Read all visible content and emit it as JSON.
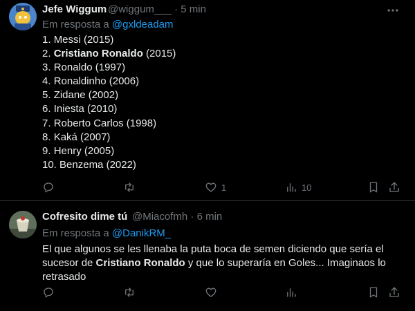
{
  "tweets": [
    {
      "author_name": "Jefe Wiggum",
      "author_handle": "@wiggum___",
      "separator": "·",
      "time": "5 min",
      "reply_prefix": "Em resposta a",
      "reply_to": "@gxldeadam",
      "list": [
        {
          "prefix": "1. ",
          "bold": "",
          "suffix": "Messi (2015)"
        },
        {
          "prefix": "2. ",
          "bold": "Cristiano Ronaldo",
          "suffix": " (2015)"
        },
        {
          "prefix": "3. ",
          "bold": "",
          "suffix": "Ronaldo (1997)"
        },
        {
          "prefix": "4. ",
          "bold": "",
          "suffix": "Ronaldinho (2006)"
        },
        {
          "prefix": "5. ",
          "bold": "",
          "suffix": "Zidane (2002)"
        },
        {
          "prefix": "6. ",
          "bold": "",
          "suffix": "Iniesta (2010)"
        },
        {
          "prefix": "7. ",
          "bold": "",
          "suffix": "Roberto Carlos (1998)"
        },
        {
          "prefix": "8. ",
          "bold": "",
          "suffix": "Kaká (2007)"
        },
        {
          "prefix": "9. ",
          "bold": "",
          "suffix": "Henry (2005)"
        },
        {
          "prefix": "10. ",
          "bold": "",
          "suffix": "Benzema (2022)"
        }
      ],
      "actions": {
        "replies": "",
        "retweets": "",
        "likes": "1",
        "views": "10"
      }
    },
    {
      "author_name": "Cofresito dime tú",
      "author_handle": "@Miacofmh",
      "separator": "·",
      "time": "6 min",
      "reply_prefix": "Em resposta a",
      "reply_to": "@DanikRM_",
      "body": {
        "part1": "El que algunos se les llenaba la puta boca de semen diciendo que sería el sucesor de ",
        "bold": "Cristiano Ronaldo",
        "part2": " y que lo superaría en Goles... Imaginaos lo retrasado"
      },
      "actions": {
        "replies": "",
        "retweets": "",
        "likes": "",
        "views": ""
      }
    }
  ],
  "icons": {
    "reply": "reply-icon",
    "retweet": "retweet-icon",
    "like": "heart-icon",
    "views": "views-icon",
    "bookmark": "bookmark-icon",
    "share": "share-icon",
    "more": "more-icon"
  },
  "colors": {
    "background": "#000000",
    "text": "#e7e9ea",
    "secondary": "#71767b",
    "link": "#1d9bf0",
    "divider": "#2f3336"
  }
}
